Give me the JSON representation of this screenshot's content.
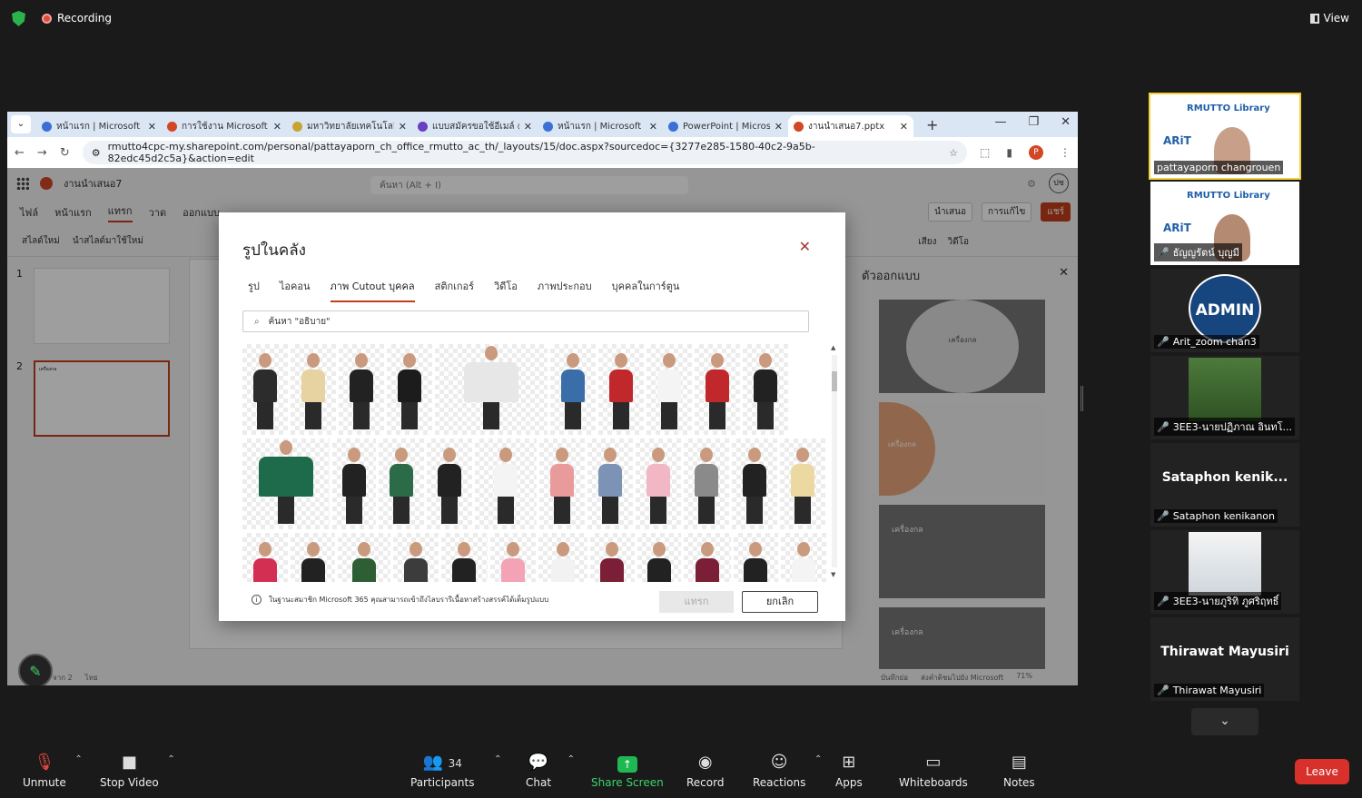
{
  "zoom": {
    "recording_label": "Recording",
    "view_label": "View",
    "toolbar": {
      "unmute": "Unmute",
      "stop_video": "Stop Video",
      "participants": "Participants",
      "participants_count": "34",
      "chat": "Chat",
      "share_screen": "Share Screen",
      "record": "Record",
      "reactions": "Reactions",
      "apps": "Apps",
      "whiteboards": "Whiteboards",
      "notes": "Notes",
      "leave": "Leave"
    },
    "participants": [
      {
        "name": "pattayaporn changrouen",
        "banner": "RMUTTO Library",
        "logo": "ARiT"
      },
      {
        "name": "ธัญญรัตน์  บุญมี",
        "banner": "RMUTTO Library",
        "logo": "ARiT"
      },
      {
        "name": "Arit_zoom chan3",
        "avatar_text": "ADMIN"
      },
      {
        "name": "3EE3-นายปฏิภาณ อินทโ..."
      },
      {
        "name": "Sataphon kenikanon",
        "display": "Sataphon  kenik..."
      },
      {
        "name": "3EE3-นายภูริทิ ภูศริฤทธิ์"
      },
      {
        "name": "Thirawat Mayusiri",
        "display": "Thirawat Mayusiri"
      }
    ]
  },
  "browser": {
    "tabs": [
      {
        "title": "หน้าแรก | Microsoft 365",
        "color": "#3b6fd4"
      },
      {
        "title": "การใช้งาน Microsoft PowerPoint",
        "color": "#d24726"
      },
      {
        "title": "มหาวิทยาลัยเทคโนโลยีราชมงคล",
        "color": "#c8a434"
      },
      {
        "title": "แบบสมัครขอใช้อีเมล์ @rmutto",
        "color": "#6b3fbf"
      },
      {
        "title": "หน้าแรก | Microsoft 365",
        "color": "#3b6fd4"
      },
      {
        "title": "PowerPoint | Microsoft 365",
        "color": "#3b6fd4"
      },
      {
        "title": "งานนำเสนอ7.pptx",
        "color": "#d24726"
      }
    ],
    "url": "rmutto4cpc-my.sharepoint.com/personal/pattayaporn_ch_office_rmutto_ac_th/_layouts/15/doc.aspx?sourcedoc={3277e285-1580-40c2-9a5b-82edc45d2c5a}&action=edit",
    "profile_letter": "P"
  },
  "ppt": {
    "file_name": "งานนำเสนอ7",
    "search_placeholder": "ค้นหา (Alt + I)",
    "avatar": "ปช",
    "menus": [
      "ไฟล์",
      "หน้าแรก",
      "แทรก",
      "วาด",
      "ออกแบบ"
    ],
    "menu_present": "นำเสนอ",
    "menu_edit": "การแก้ไข",
    "menu_share": "แชร์",
    "ribbon_left": [
      "สไลด์ใหม่",
      "นำสไลด์มาใช้ใหม่"
    ],
    "ribbon_right": [
      "เสียง",
      "วิดีโอ"
    ],
    "slides": [
      "1",
      "2"
    ],
    "slide2_text": "เครื่องกล",
    "design_title": "ตัวออกแบบ",
    "design_cards": [
      "เครื่องกล",
      "เครื่องกล",
      "เครื่องกล",
      "เครื่องกล"
    ],
    "status_left": "จาก 2",
    "status_lang": "ไทย",
    "status_notes": "บันทึกย่อ",
    "status_feedback": "ส่งคำติชมไปยัง Microsoft",
    "zoom_level": "71%"
  },
  "dialog": {
    "title": "รูปในคลัง",
    "tabs": [
      "รูป",
      "ไอคอน",
      "ภาพ Cutout บุคคล",
      "สติกเกอร์",
      "วิดีโอ",
      "ภาพประกอบ",
      "บุคคลในการ์ตูน"
    ],
    "active_tab": "ภาพ Cutout บุคคล",
    "search_value": "ค้นหา \"อธิบาย\"",
    "footer_text": "ในฐานะสมาชิก Microsoft 365 คุณสามารถเข้าถึงไลบรารีเนื้อหาสร้างสรรค์ได้เต็มรูปแบบ",
    "insert_label": "แทรก",
    "cancel_label": "ยกเลิก",
    "colors": {
      "accent": "#c43e1c"
    }
  }
}
